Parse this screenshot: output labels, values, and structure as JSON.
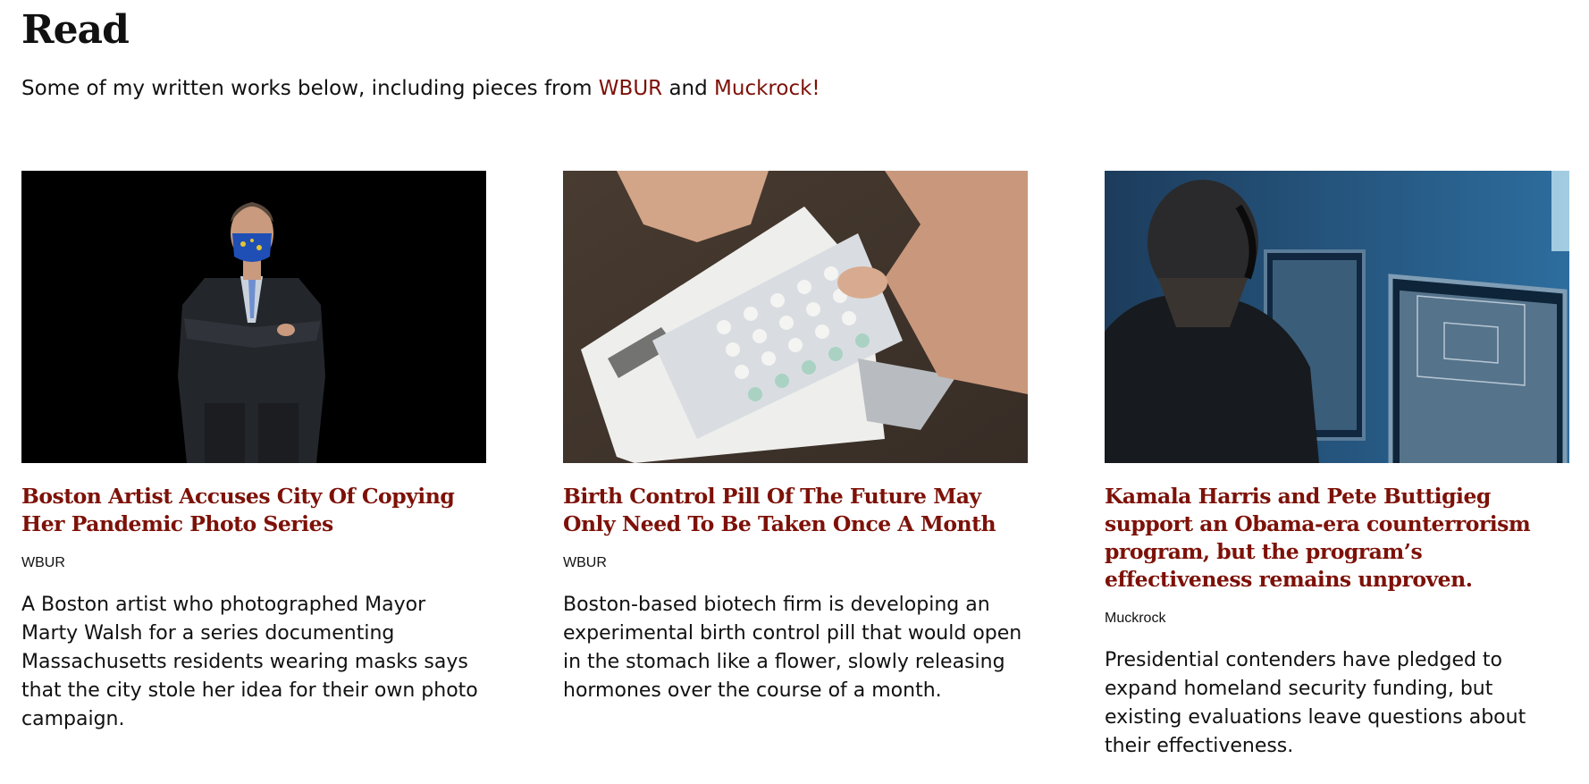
{
  "header": {
    "title": "Read",
    "intro_prefix": "Some of my written works below, including pieces from ",
    "intro_link1": "WBUR",
    "intro_middle": " and ",
    "intro_link2": "Muckrock!"
  },
  "colors": {
    "accent": "#7d1108",
    "text": "#111111",
    "background": "#ffffff"
  },
  "articles": [
    {
      "title": "Boston Artist Accuses City Of Copying Her Pandemic Photo Series",
      "source": "WBUR",
      "summary": "A Boston artist who photographed Mayor Marty Walsh for a series documenting Massachusetts residents wearing masks says that the city stole her idea for their own photo campaign.",
      "image": "portrait-masked-man-photo"
    },
    {
      "title": "Birth Control Pill Of The Future May Only Need To Be Taken Once A Month",
      "source": "WBUR",
      "summary": "Boston-based biotech firm is developing an experimental birth control pill that would open in the stomach like a flower, slowly releasing hormones over the course of a month.",
      "image": "birth-control-pack-photo"
    },
    {
      "title": "Kamala Harris and Pete Buttigieg support an Obama-era counterrorism program, but the program’s effectiveness remains unproven.",
      "source": "Muckrock",
      "summary": "Presidential contenders have pledged to expand homeland security funding, but existing evaluations leave questions about their effectiveness.",
      "image": "surveillance-monitors-photo"
    }
  ]
}
